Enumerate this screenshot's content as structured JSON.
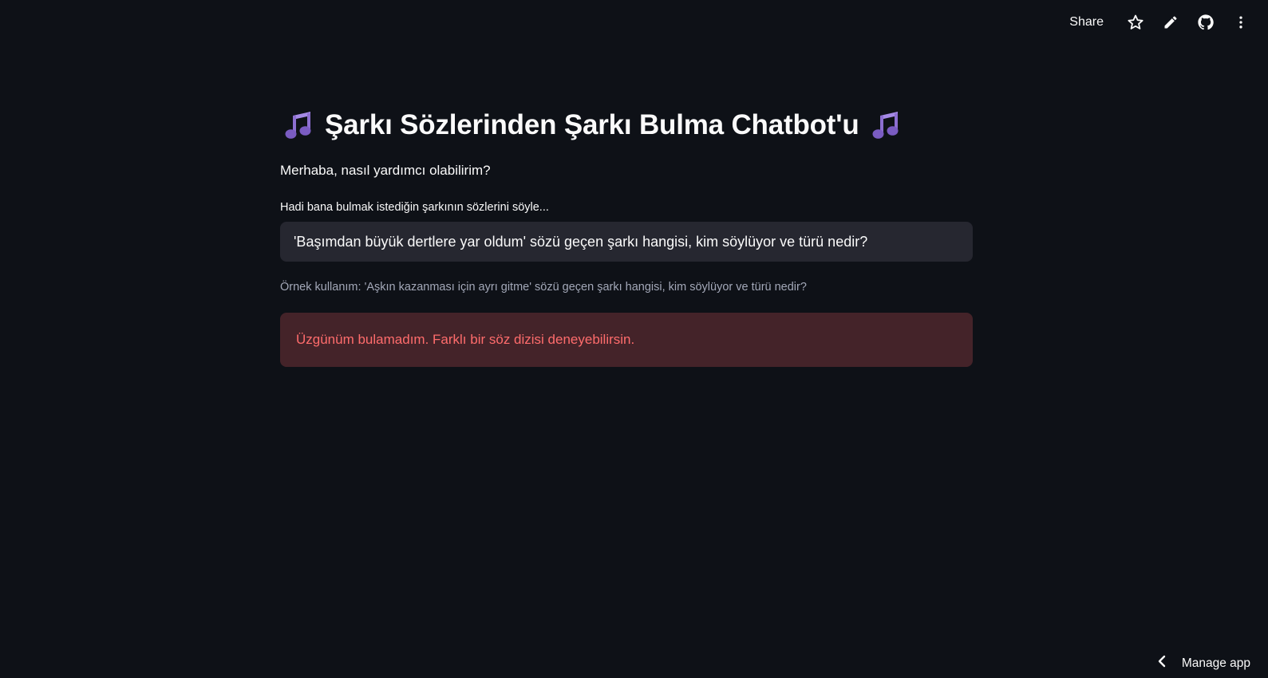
{
  "toolbar": {
    "share_label": "Share",
    "icons": [
      "star-icon",
      "pencil-icon",
      "github-icon",
      "more-vertical-icon"
    ]
  },
  "header": {
    "title": "Şarkı Sözlerinden Şarkı Bulma Chatbot'u",
    "title_icon": "musical-notes-icon"
  },
  "main": {
    "greeting": "Merhaba, nasıl yardımcı olabilirim?",
    "input": {
      "label": "Hadi bana bulmak istediğin şarkının sözlerini söyle...",
      "value": "'Başımdan büyük dertlere yar oldum' sözü geçen şarkı hangisi, kim söylüyor ve türü nedir?"
    },
    "example_text": "Örnek kullanım: 'Aşkın kazanması için ayrı gitme' sözü geçen şarkı hangisi, kim söylüyor ve türü nedir?",
    "error_message": "Üzgünüm bulamadım. Farklı bir söz dizisi deneyebilirsin."
  },
  "footer": {
    "manage_label": "Manage app"
  },
  "colors": {
    "background": "#0e1117",
    "input_bg": "#262730",
    "error_bg": "#442329",
    "error_text": "#ff6c6c",
    "caption_text": "#a3a8b8",
    "note_icon": "#8d6fd1"
  }
}
